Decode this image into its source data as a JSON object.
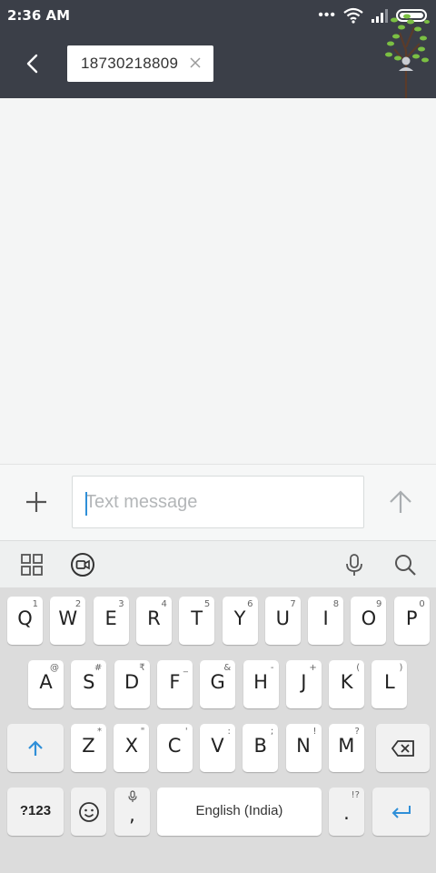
{
  "status_bar": {
    "time": "2:36 AM",
    "dots": "•••"
  },
  "header": {
    "recipient": "18730218809"
  },
  "compose": {
    "placeholder": "Text message"
  },
  "keyboard": {
    "row1": [
      {
        "k": "Q",
        "s": "1"
      },
      {
        "k": "W",
        "s": "2"
      },
      {
        "k": "E",
        "s": "3"
      },
      {
        "k": "R",
        "s": "4"
      },
      {
        "k": "T",
        "s": "5"
      },
      {
        "k": "Y",
        "s": "6"
      },
      {
        "k": "U",
        "s": "7"
      },
      {
        "k": "I",
        "s": "8"
      },
      {
        "k": "O",
        "s": "9"
      },
      {
        "k": "P",
        "s": "0"
      }
    ],
    "row2": [
      {
        "k": "A",
        "s": "@"
      },
      {
        "k": "S",
        "s": "#"
      },
      {
        "k": "D",
        "s": "₹"
      },
      {
        "k": "F",
        "s": "_"
      },
      {
        "k": "G",
        "s": "&"
      },
      {
        "k": "H",
        "s": "-"
      },
      {
        "k": "J",
        "s": "+"
      },
      {
        "k": "K",
        "s": "("
      },
      {
        "k": "L",
        "s": ")"
      }
    ],
    "row3": [
      {
        "k": "Z",
        "s": "*"
      },
      {
        "k": "X",
        "s": "\""
      },
      {
        "k": "C",
        "s": "'"
      },
      {
        "k": "V",
        "s": ":"
      },
      {
        "k": "B",
        "s": ";"
      },
      {
        "k": "N",
        "s": "!"
      },
      {
        "k": "M",
        "s": "?"
      }
    ],
    "symbols_label": "?123",
    "comma": ",",
    "space_label": "English (India)",
    "period": ".",
    "period_sub": "!?"
  },
  "colors": {
    "accent": "#2f8fd8",
    "header_bg": "#3b3f48"
  }
}
